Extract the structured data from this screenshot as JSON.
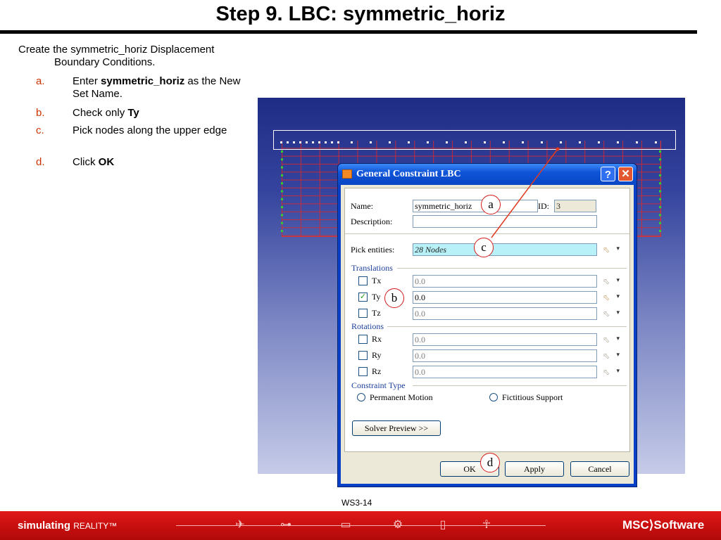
{
  "slide": {
    "title": "Step 9. LBC: symmetric_horiz",
    "intro_line1": "Create the symmetric_horiz Displacement",
    "intro_line2": "Boundary Conditions.",
    "steps": [
      {
        "letter": "a.",
        "pre": "Enter ",
        "bold": "symmetric_horiz",
        "post": " as the New Set Name."
      },
      {
        "letter": "b.",
        "pre": "Check only ",
        "bold": "Ty",
        "post": ""
      },
      {
        "letter": "c.",
        "pre": "Pick nodes along the upper edge",
        "bold": "",
        "post": ""
      },
      {
        "letter": "d.",
        "pre": "Click ",
        "bold": "OK",
        "post": ""
      }
    ],
    "page_code": "WS3-14"
  },
  "dialog": {
    "title": "General Constraint LBC",
    "name_label": "Name:",
    "name_value": "symmetric_horiz",
    "id_label": "ID:",
    "id_value": "3",
    "description_label": "Description:",
    "description_value": "",
    "pick_label": "Pick entities:",
    "pick_value": "28 Nodes",
    "translations_header": "Translations",
    "rotations_header": "Rotations",
    "dofs": [
      {
        "label": "Tx",
        "value": "0.0",
        "checked": false
      },
      {
        "label": "Ty",
        "value": "0.0",
        "checked": true
      },
      {
        "label": "Tz",
        "value": "0.0",
        "checked": false
      },
      {
        "label": "Rx",
        "value": "0.0",
        "checked": false
      },
      {
        "label": "Ry",
        "value": "0.0",
        "checked": false
      },
      {
        "label": "Rz",
        "value": "0.0",
        "checked": false
      }
    ],
    "constraint_type_header": "Constraint Type",
    "radio_permanent": "Permanent Motion",
    "radio_fictitious": "Fictitious Support",
    "solver_preview": "Solver Preview >>",
    "ok": "OK",
    "apply": "Apply",
    "cancel": "Cancel",
    "help_glyph": "?",
    "close_glyph": "✕"
  },
  "callouts": {
    "a": "a",
    "b": "b",
    "c": "c",
    "d": "d"
  },
  "footer": {
    "brand": "simulating",
    "brand_small": "REALITY™",
    "logo": "MSC⟩Software"
  },
  "colors": {
    "accent_red": "#d51b1b",
    "step_letter": "#cc3300",
    "footer_red": "#c40d0d",
    "dialog_blue": "#0a3fc8"
  }
}
